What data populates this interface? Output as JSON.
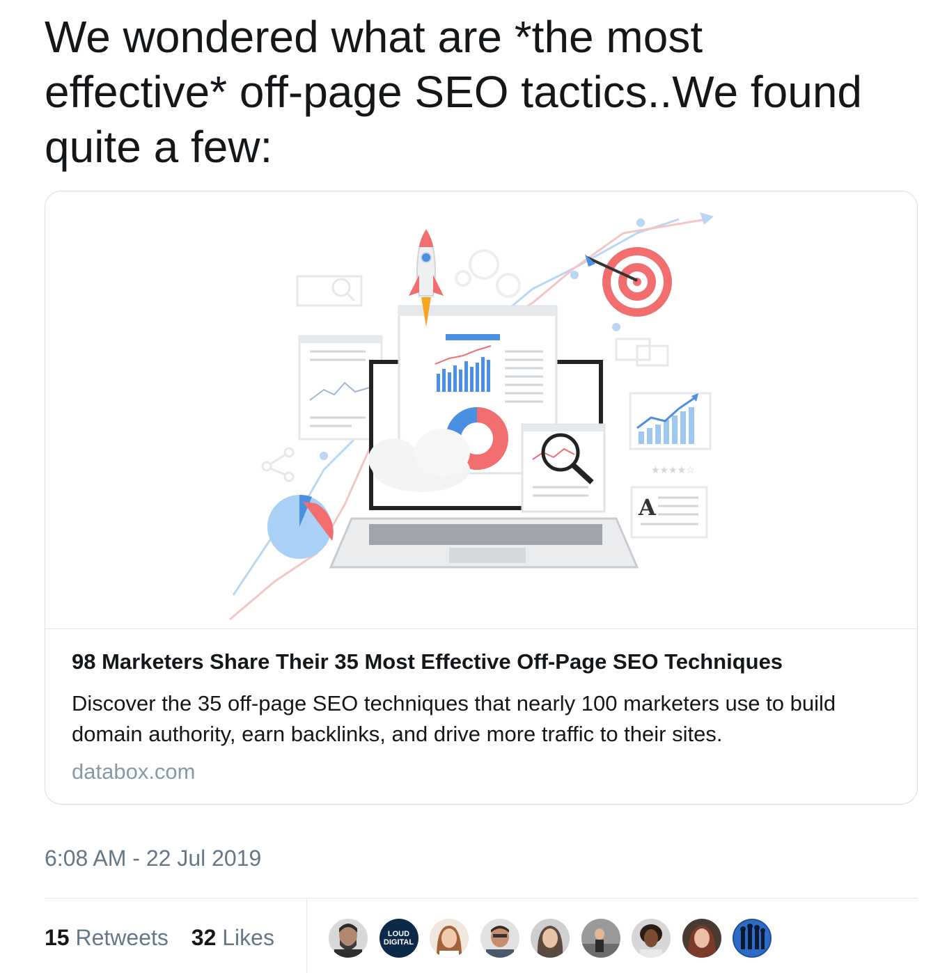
{
  "tweet": {
    "text": "We wondered what are *the most effective* off-page SEO tactics..We found quite a few:",
    "timestamp": "6:08 AM - 22 Jul 2019"
  },
  "card": {
    "title": "98 Marketers Share Their 35 Most Effective Off-Page SEO Techniques",
    "description": "Discover the 35 off-page SEO techniques that nearly 100 marketers use to build domain authority, earn backlinks, and drive more traffic to their sites.",
    "domain": "databox.com",
    "illustration_letter": "A"
  },
  "stats": {
    "retweets_count": "15",
    "retweets_label": "Retweets",
    "likes_count": "32",
    "likes_label": "Likes"
  },
  "avatars": [
    {
      "name": "avatar-1"
    },
    {
      "name": "avatar-loud-digital",
      "line1": "LOUD",
      "line2": "DIGITAL"
    },
    {
      "name": "avatar-3"
    },
    {
      "name": "avatar-4"
    },
    {
      "name": "avatar-5"
    },
    {
      "name": "avatar-6"
    },
    {
      "name": "avatar-7"
    },
    {
      "name": "avatar-8"
    },
    {
      "name": "avatar-9"
    }
  ],
  "colors": {
    "text": "#14171a",
    "secondary": "#657786",
    "domain": "#8899a6",
    "accent_blue": "#4a90e2",
    "accent_red": "#f26d6d"
  }
}
